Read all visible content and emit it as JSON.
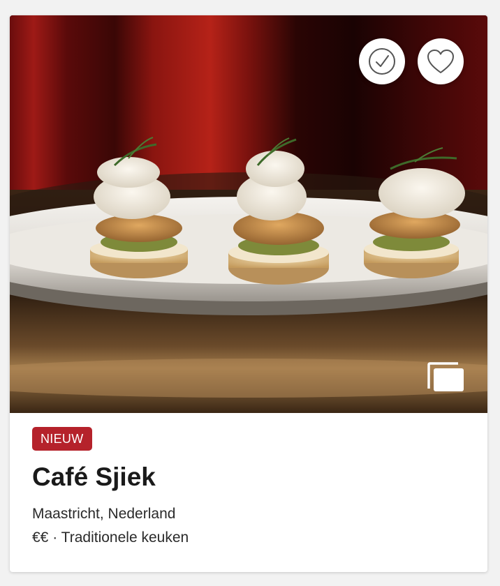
{
  "card": {
    "badge": "NIEUW",
    "title": "Café Sjiek",
    "location": "Maastricht, Nederland",
    "price": "€€",
    "separator": "·",
    "cuisine": "Traditionele keuken"
  },
  "photo": {
    "description_icon": "food-photo",
    "actions": [
      {
        "name": "visited",
        "icon": "check-circle-icon"
      },
      {
        "name": "favorite",
        "icon": "heart-icon"
      }
    ],
    "gallery_icon": "gallery-icon"
  },
  "colors": {
    "badge_bg": "#b5222b",
    "title": "#1a1a1a",
    "text": "#2a2a2a",
    "card_bg": "#ffffff"
  }
}
